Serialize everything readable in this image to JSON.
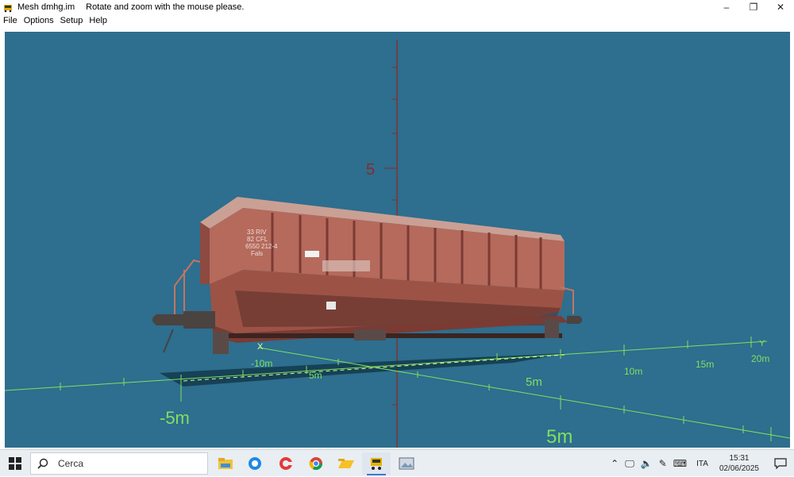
{
  "window": {
    "title": "Mesh dmhg.im",
    "hint": "Rotate and zoom with the mouse please.",
    "controls": {
      "minimize": "–",
      "restore": "❐",
      "close": "✕"
    }
  },
  "menu": {
    "items": [
      "File",
      "Options",
      "Setup",
      "Help"
    ]
  },
  "scene": {
    "background": "#2e6e8e",
    "axis_color": "#7fe060",
    "vertical_axis_color": "#8a2a2a",
    "ground_labels": {
      "x_axis": "X",
      "y_axis": "Y",
      "neg_ten": "-10m",
      "neg_five_left": "-5m",
      "five_back": "5m",
      "ten": "10m",
      "fifteen": "15m",
      "twenty": "20m",
      "five_near": "5m",
      "five_front": "5m"
    },
    "vertical_label": "5",
    "wagon": {
      "text_lines": [
        "33 RIV",
        "82 CFL",
        "6550 212-4",
        "Fals"
      ],
      "body_color": "#b56a5c"
    }
  },
  "taskbar": {
    "search_placeholder": "Cerca",
    "apps": [
      "file-explorer",
      "browser-edge",
      "cleaner",
      "chrome",
      "folder",
      "mesh-viewer",
      "image-viewer"
    ],
    "tray": {
      "lang": "ITA",
      "time": "15:31",
      "date": "02/06/2025"
    }
  }
}
